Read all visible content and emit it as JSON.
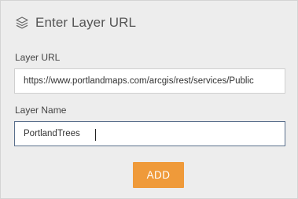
{
  "dialog": {
    "title": "Enter Layer URL",
    "icon": "layers-icon"
  },
  "layer_url": {
    "label": "Layer URL",
    "value": "https://www.portlandmaps.com/arcgis/rest/services/Public"
  },
  "layer_name": {
    "label": "Layer Name",
    "value": "PortlandTrees"
  },
  "actions": {
    "add_label": "ADD"
  },
  "colors": {
    "accent": "#ef9a3a",
    "panel_bg": "#ededed",
    "focus_border": "#5a6f8c"
  }
}
